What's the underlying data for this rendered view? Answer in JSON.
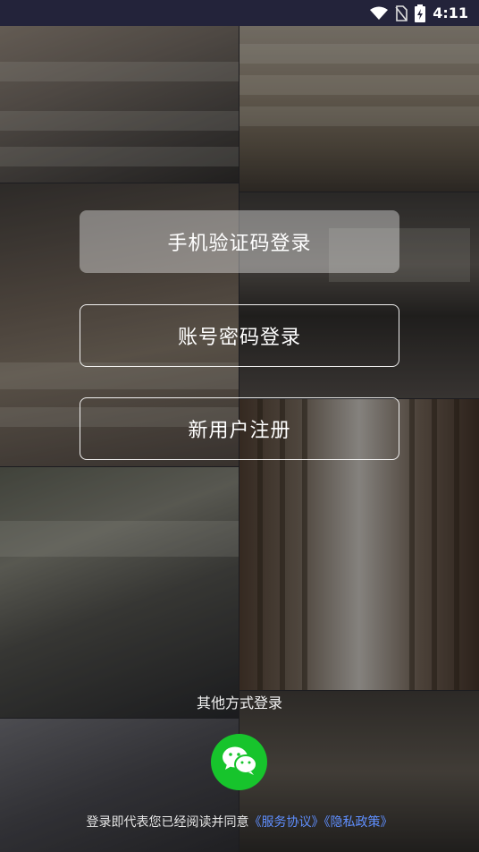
{
  "status_bar": {
    "time": "4:11"
  },
  "buttons": {
    "phone_code_login": "手机验证码登录",
    "account_password_login": "账号密码登录",
    "new_user_register": "新用户注册"
  },
  "other_login": {
    "label": "其他方式登录",
    "wechat_icon": "wechat-icon"
  },
  "agreement": {
    "prefix": "登录即代表您已经阅读并同意",
    "service_agreement": "《服务协议》",
    "privacy_policy": "《隐私政策》"
  },
  "colors": {
    "status_bar_bg": "#23233a",
    "wechat_green": "#17c42c",
    "link_blue": "#5f8fff"
  }
}
